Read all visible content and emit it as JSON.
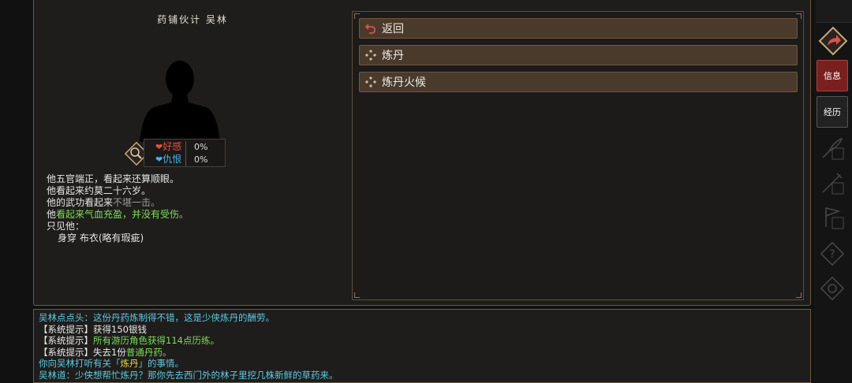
{
  "npc": {
    "title": "药铺伙计 吴林",
    "relations": [
      {
        "label": "好感",
        "value": "0%",
        "color": "#e8503a"
      },
      {
        "label": "仇恨",
        "value": "0%",
        "color": "#4ab0e8"
      }
    ]
  },
  "description": {
    "line1": "他五官端正，看起来还算顺眼。",
    "line2": "他看起来约莫二十六岁。",
    "line3_prefix": "他的武功看起来",
    "line3_status": "不堪一击。",
    "line4_prefix": "他",
    "line4_status": "看起来气血充盈，并没有受伤。",
    "line5": "只见他：",
    "line6": "身穿 布衣(略有瑕疵)"
  },
  "menu": {
    "items": [
      {
        "label": "返回",
        "icon": "return-arrow-icon"
      },
      {
        "label": "炼丹",
        "icon": "diamond-icon"
      },
      {
        "label": "炼丹火候",
        "icon": "diamond-icon"
      }
    ]
  },
  "log": {
    "l1": "吴林点点头：这份丹药炼制得不错，这是少侠炼丹的酬劳。",
    "l2a": "【系统提示】",
    "l2b": "获得150银钱",
    "l3a": "【系统提示】",
    "l3b": "所有游历角色获得114点历练。",
    "l4a": "【系统提示】",
    "l4b": "失去1份",
    "l4c": "普通丹药。",
    "l5a": "你向吴林打听有关「",
    "l5b": "炼丹",
    "l5c": "」的事情。",
    "l6": "吴林道：少侠想帮忙炼丹？那你先去西门外的林子里挖几株新鲜的草药来。"
  },
  "sidebar": {
    "info_label": "信息",
    "history_label": "经历",
    "accent": "#7a1f1f"
  }
}
